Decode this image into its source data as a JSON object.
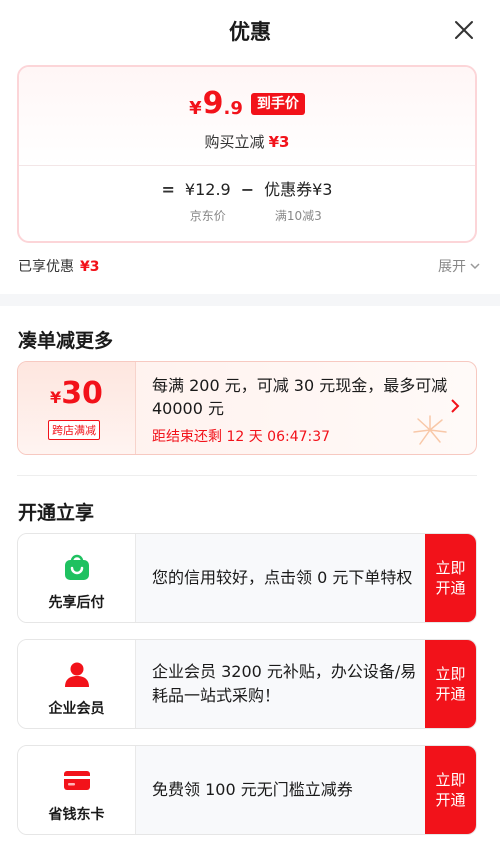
{
  "header": {
    "title": "优惠"
  },
  "price_card": {
    "yen": "¥",
    "price_int": "9",
    "price_dec": ".9",
    "final_badge": "到手价",
    "instant_label": "购买立减",
    "instant_amount": "¥3",
    "formula": {
      "equals": "=",
      "minus": "−",
      "jd_price": "¥12.9",
      "jd_price_label": "京东价",
      "coupon": "优惠券¥3",
      "coupon_label": "满10减3"
    }
  },
  "enjoyed": {
    "label": "已享优惠",
    "amount": "¥3",
    "expand_label": "展开"
  },
  "more_section": {
    "title": "凑单减更多",
    "promo": {
      "yen": "¥",
      "amount": "30",
      "tag": "跨店满减",
      "desc": "每满 200 元，可减 30 元现金，最多可减 40000 元",
      "countdown": "距结束还剩 12 天 06:47:37"
    }
  },
  "open_section": {
    "title": "开通立享",
    "items": [
      {
        "name": "先享后付",
        "icon": "shopping-bag-icon",
        "desc": "您的信用较好，点击领 0 元下单特权",
        "button": "立即开通"
      },
      {
        "name": "企业会员",
        "icon": "user-icon",
        "desc": "企业会员 3200 元补贴，办公设备/易耗品一站式采购！",
        "button": "立即开通"
      },
      {
        "name": "省钱东卡",
        "icon": "card-icon",
        "desc": "免费领 100 元无门槛立减券",
        "button": "立即开通"
      }
    ]
  },
  "colors": {
    "accent": "#f2121a",
    "success": "#1fc160",
    "page_bg": "#ffffff"
  }
}
